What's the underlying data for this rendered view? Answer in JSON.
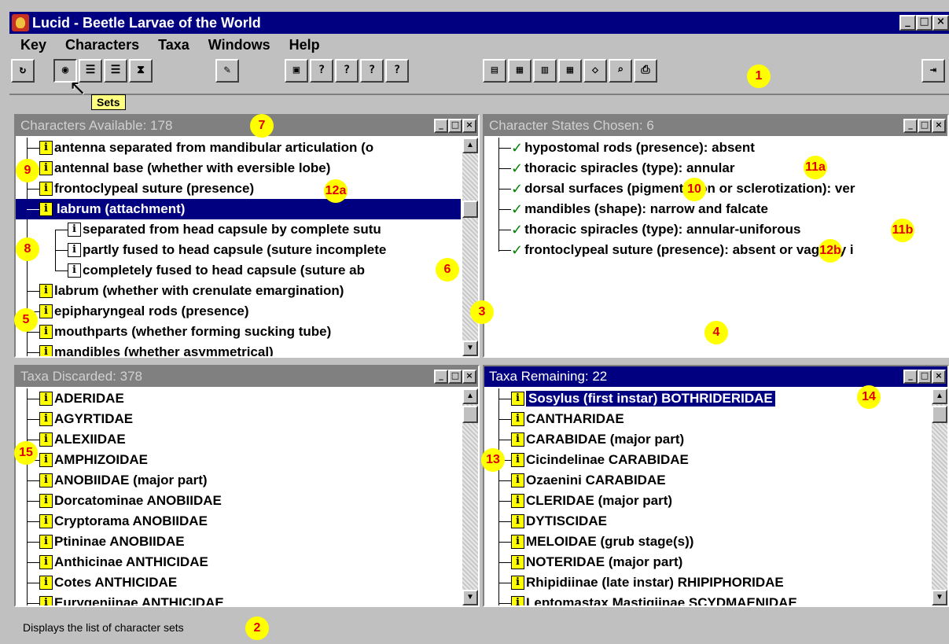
{
  "window": {
    "title": "Lucid - Beetle Larvae of the World",
    "buttons": [
      "_",
      "□",
      "×"
    ]
  },
  "menu": [
    "Key",
    "Characters",
    "Taxa",
    "Windows",
    "Help"
  ],
  "toolbar": {
    "tooltip": "Sets"
  },
  "panels": {
    "chars_available": {
      "title": "Characters Available: 178",
      "items": [
        "antenna separated from mandibular articulation (o",
        "antennal base (whether with eversible lobe)",
        "frontoclypeal suture (presence)",
        "labrum (attachment)",
        "separated from head capsule by complete sutu",
        "partly fused to head capsule (suture incomplete",
        "completely fused to head capsule (suture ab",
        "labrum (whether with crenulate emargination)",
        "epipharyngeal rods (presence)",
        "mouthparts (whether forming sucking tube)",
        "mandibles (whether asymmetrical)"
      ]
    },
    "states_chosen": {
      "title": "Character States Chosen: 6",
      "items": [
        "hypostomal rods (presence): absent",
        "thoracic spiracles (type): annular",
        "dorsal surfaces (pigmentation or sclerotization): ver",
        "mandibles (shape): narrow and falcate",
        "thoracic spiracles (type): annular-uniforous",
        "frontoclypeal suture (presence): absent or vaguely i"
      ]
    },
    "taxa_discarded": {
      "title": "Taxa Discarded: 378",
      "items": [
        "ADERIDAE",
        "AGYRTIDAE",
        "ALEXIIDAE",
        "AMPHIZOIDAE",
        "ANOBIIDAE (major part)",
        "Dorcatominae ANOBIIDAE",
        "Cryptorama ANOBIIDAE",
        "Ptininae ANOBIIDAE",
        "Anthicinae ANTHICIDAE",
        "Cotes ANTHICIDAE",
        "Eurygeniinae ANTHICIDAE"
      ]
    },
    "taxa_remaining": {
      "title": "Taxa Remaining: 22",
      "items": [
        "Sosylus (first instar) BOTHRIDERIDAE",
        "CANTHARIDAE",
        "CARABIDAE (major part)",
        "Cicindelinae CARABIDAE",
        "Ozaenini CARABIDAE",
        "CLERIDAE (major part)",
        "DYTISCIDAE",
        "MELOIDAE (grub stage(s))",
        "NOTERIDAE (major part)",
        "Rhipidiinae (late instar) RHIPIPHORIDAE",
        "Leptomastax Mastigiinae SCYDMAENIDAE"
      ]
    }
  },
  "status": "Displays the list of character sets",
  "callouts": [
    "1",
    "2",
    "3",
    "4",
    "5",
    "6",
    "7",
    "8",
    "9",
    "10",
    "11a",
    "11b",
    "12a",
    "12b",
    "13",
    "14",
    "15"
  ],
  "colors": {
    "title_active": "#000080",
    "title_inactive": "#808080",
    "info_box": "#ffff00",
    "callout_fill": "#ffff00",
    "callout_text": "#e00000",
    "check": "#008000"
  }
}
